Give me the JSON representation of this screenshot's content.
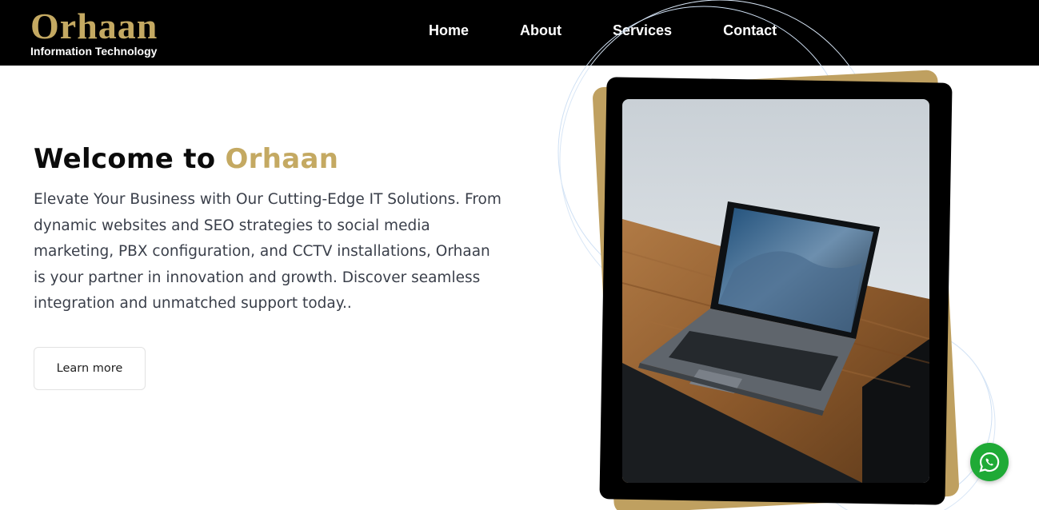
{
  "brand": {
    "name": "Orhaan",
    "tagline": "Information Technology"
  },
  "nav": {
    "items": [
      {
        "label": "Home"
      },
      {
        "label": "About"
      },
      {
        "label": "Services"
      },
      {
        "label": "Contact"
      }
    ]
  },
  "hero": {
    "title_prefix": "Welcome to",
    "title_accent": "Orhaan",
    "description": "Elevate Your Business with Our Cutting-Edge IT Solutions. From dynamic websites and SEO strategies to social media marketing, PBX configuration, and CCTV installations, Orhaan is your partner in innovation and growth. Discover seamless integration and unmatched support today..",
    "cta_label": "Learn more"
  },
  "hero_image": {
    "subject": "laptop on wooden desk"
  },
  "floating": {
    "whatsapp_icon": "whatsapp-icon"
  },
  "colors": {
    "navbar_bg": "#000000",
    "brand_gold": "#C4A962",
    "card_gold": "#BFA060",
    "whatsapp_green": "#1FAA36"
  }
}
